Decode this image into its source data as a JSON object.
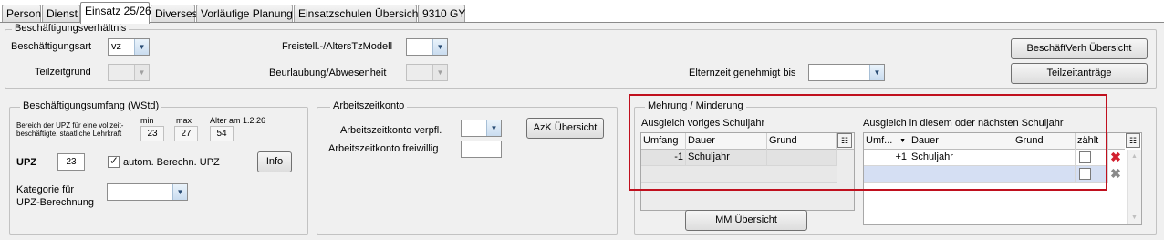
{
  "tabs": [
    {
      "label": "Person",
      "active": false
    },
    {
      "label": "Dienst",
      "active": false
    },
    {
      "label": "Einsatz 25/26",
      "active": true
    },
    {
      "label": "Diverses",
      "active": false
    },
    {
      "label": "Vorläufige Planung",
      "active": false
    },
    {
      "label": "Einsatzschulen Übersicht",
      "active": false
    },
    {
      "label": "9310 GY",
      "active": false
    }
  ],
  "beschaeftigung": {
    "title": "Beschäftigungsverhältnis",
    "art_label": "Beschäftigungsart",
    "art_value": "vz",
    "teilzeitgrund_label": "Teilzeitgrund",
    "teilzeitgrund_value": "",
    "freistell_label": "Freistell.-/AltersTzModell",
    "freistell_value": "",
    "beurlaubung_label": "Beurlaubung/Abwesenheit",
    "beurlaubung_value": "",
    "elternzeit_label": "Elternzeit genehmigt bis",
    "elternzeit_value": "",
    "btn_verh": "BeschäftVerh Übersicht",
    "btn_teilzeit": "Teilzeitanträge"
  },
  "umfang": {
    "title": "Beschäftigungsumfang (WStd)",
    "bereich_text": "Bereich der UPZ für eine vollzeit-beschäftigte, staatliche Lehrkraft",
    "min_label": "min",
    "max_label": "max",
    "alter_label": "Alter am 1.2.26",
    "min_value": "23",
    "max_value": "27",
    "alter_value": "54",
    "upz_label": "UPZ",
    "upz_value": "23",
    "autom_label": "autom. Berechn. UPZ",
    "autom_checked": true,
    "info_btn": "Info",
    "kategorie_label_1": "Kategorie für",
    "kategorie_label_2": "UPZ-Berechnung",
    "kategorie_value": ""
  },
  "azk": {
    "title": "Arbeitszeitkonto",
    "verpfl_label": "Arbeitszeitkonto verpfl.",
    "verpfl_value": "",
    "freiwillig_label": "Arbeitszeitkonto freiwillig",
    "freiwillig_value": "",
    "btn": "AzK Übersicht"
  },
  "mm": {
    "title": "Mehrung / Minderung",
    "left_title": "Ausgleich voriges Schuljahr",
    "left_cols": [
      "Umfang",
      "Dauer",
      "Grund"
    ],
    "left_rows": [
      {
        "umfang": "-1",
        "dauer": "Schuljahr",
        "grund": ""
      }
    ],
    "right_title": "Ausgleich in diesem oder nächsten Schuljahr",
    "right_cols": [
      "Umf...",
      "Dauer",
      "Grund",
      "zählt"
    ],
    "right_rows": [
      {
        "umfang": "+1",
        "dauer": "Schuljahr",
        "grund": "",
        "zaehlt": false
      },
      {
        "umfang": "",
        "dauer": "",
        "grund": "",
        "zaehlt": false
      }
    ],
    "btn": "MM Übersicht"
  },
  "colors": {
    "highlight": "#c0101e",
    "selected_row": "#d5dff3"
  }
}
